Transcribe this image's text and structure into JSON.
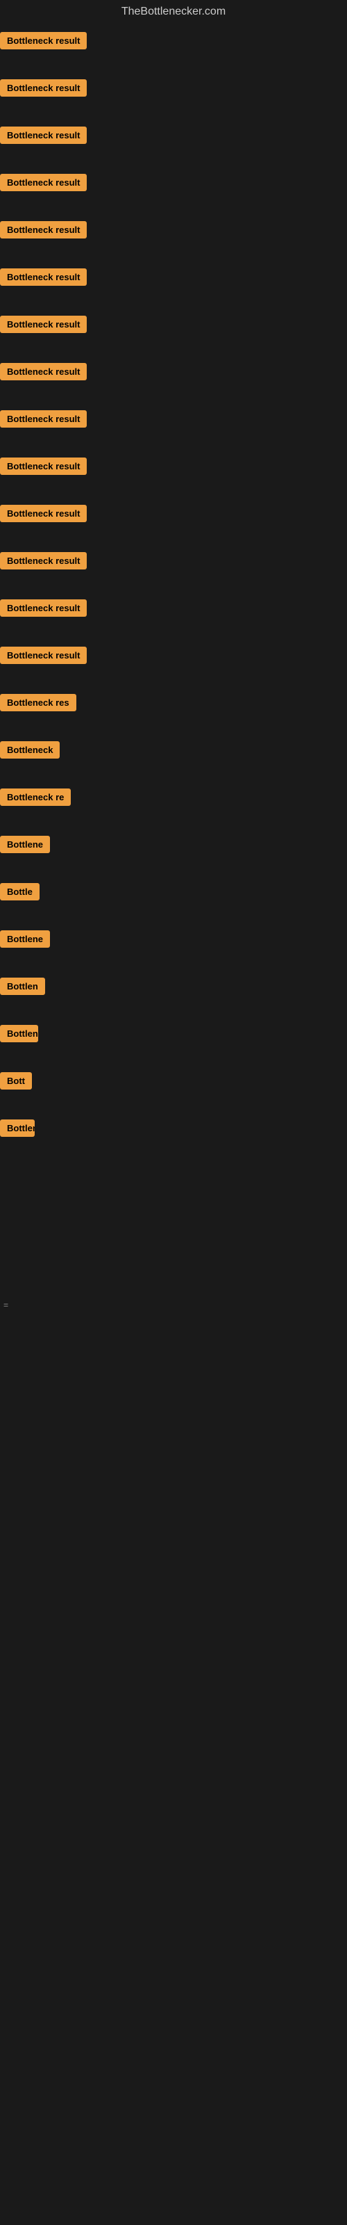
{
  "site": {
    "title": "TheBottlenecker.com"
  },
  "items": [
    {
      "id": 1,
      "label": "Bottleneck result",
      "size": "full"
    },
    {
      "id": 2,
      "label": "Bottleneck result",
      "size": "full"
    },
    {
      "id": 3,
      "label": "Bottleneck result",
      "size": "full"
    },
    {
      "id": 4,
      "label": "Bottleneck result",
      "size": "full"
    },
    {
      "id": 5,
      "label": "Bottleneck result",
      "size": "full"
    },
    {
      "id": 6,
      "label": "Bottleneck result",
      "size": "full"
    },
    {
      "id": 7,
      "label": "Bottleneck result",
      "size": "full"
    },
    {
      "id": 8,
      "label": "Bottleneck result",
      "size": "full"
    },
    {
      "id": 9,
      "label": "Bottleneck result",
      "size": "full"
    },
    {
      "id": 10,
      "label": "Bottleneck result",
      "size": "full"
    },
    {
      "id": 11,
      "label": "Bottleneck result",
      "size": "full"
    },
    {
      "id": 12,
      "label": "Bottleneck result",
      "size": "full"
    },
    {
      "id": 13,
      "label": "Bottleneck result",
      "size": "full"
    },
    {
      "id": 14,
      "label": "Bottleneck result",
      "size": "full"
    },
    {
      "id": 15,
      "label": "Bottleneck res",
      "size": "small-1"
    },
    {
      "id": 16,
      "label": "Bottleneck",
      "size": "small-2"
    },
    {
      "id": 17,
      "label": "Bottleneck re",
      "size": "small-3"
    },
    {
      "id": 18,
      "label": "Bottlene",
      "size": "small-4"
    },
    {
      "id": 19,
      "label": "Bottle",
      "size": "small-5"
    },
    {
      "id": 20,
      "label": "Bottlene",
      "size": "small-6"
    },
    {
      "id": 21,
      "label": "Bottlen",
      "size": "small-7"
    },
    {
      "id": 22,
      "label": "Bottleneck",
      "size": "small-8"
    },
    {
      "id": 23,
      "label": "Bott",
      "size": "small-9"
    },
    {
      "id": 24,
      "label": "Bottlene",
      "size": "small-10"
    }
  ],
  "bottom_marker": "=",
  "colors": {
    "badge_bg": "#f0a040",
    "badge_text": "#000000",
    "body_bg": "#1a1a1a",
    "site_title": "#cccccc"
  }
}
